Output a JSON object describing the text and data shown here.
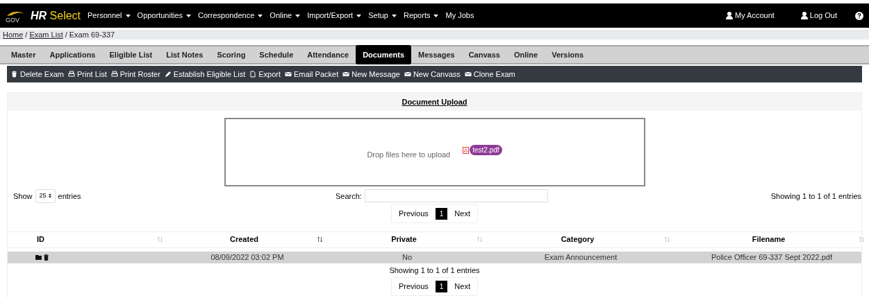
{
  "brand": {
    "logo_text": "GOV",
    "name_bold": "HR",
    "name_rest": "Select"
  },
  "menu": [
    {
      "label": "Personnel",
      "dropdown": true
    },
    {
      "label": "Opportunities",
      "dropdown": true
    },
    {
      "label": "Correspondence",
      "dropdown": true
    },
    {
      "label": "Online",
      "dropdown": true
    },
    {
      "label": "Import/Export",
      "dropdown": true
    },
    {
      "label": "Setup",
      "dropdown": true
    },
    {
      "label": "Reports",
      "dropdown": true
    },
    {
      "label": "My Jobs",
      "dropdown": false
    }
  ],
  "user_links": [
    "My Account",
    "Log Out"
  ],
  "breadcrumb_separator": "/",
  "breadcrumb": [
    {
      "label": "Home",
      "link": true
    },
    {
      "label": "Exam List",
      "link": true
    },
    {
      "label": "Exam 69-337",
      "link": false
    }
  ],
  "tabs": [
    {
      "label": "Master",
      "selected": false
    },
    {
      "label": "Applications",
      "selected": false
    },
    {
      "label": "Eligible List",
      "selected": false
    },
    {
      "label": "List Notes",
      "selected": false
    },
    {
      "label": "Scoring",
      "selected": false
    },
    {
      "label": "Schedule",
      "selected": false
    },
    {
      "label": "Attendance",
      "selected": false
    },
    {
      "label": "Documents",
      "selected": true
    },
    {
      "label": "Messages",
      "selected": false
    },
    {
      "label": "Canvass",
      "selected": false
    },
    {
      "label": "Online",
      "selected": false
    },
    {
      "label": "Versions",
      "selected": false
    }
  ],
  "toolbar": [
    {
      "label": "Delete Exam",
      "kind": "trash"
    },
    {
      "label": "Print List",
      "kind": "print"
    },
    {
      "label": "Print Roster",
      "kind": "print"
    },
    {
      "label": "Establish Eligible List",
      "kind": "pencil"
    },
    {
      "label": "Export",
      "kind": "file"
    },
    {
      "label": "Email Packet",
      "kind": "mail"
    },
    {
      "label": "New Message",
      "kind": "mail"
    },
    {
      "label": "New Canvass",
      "kind": "mail"
    },
    {
      "label": "Clone Exam",
      "kind": "mail"
    }
  ],
  "panel": {
    "title": "Document Upload",
    "dropzone": {
      "message": "Drop files here to upload",
      "file": "test2.pdf"
    }
  },
  "table_controls": {
    "show_label": "Show",
    "page_size": "25",
    "entries_label": "entries",
    "search_label": "Search:",
    "info": "Showing 1 to 1 of 1 entries"
  },
  "pagination_top": {
    "previous": "Previous",
    "pages": [
      {
        "label": "1",
        "selected": true
      }
    ],
    "next": "Next"
  },
  "table": {
    "columns": [
      {
        "label": "ID",
        "sorted": false
      },
      {
        "label": "Created",
        "sorted": true
      },
      {
        "label": "Private",
        "sorted": false
      },
      {
        "label": "Category",
        "sorted": false
      },
      {
        "label": "Filename",
        "sorted": false
      }
    ],
    "rows": [
      {
        "created": "08/09/2022 03:02 PM",
        "private": "No",
        "category": "Exam Announcement",
        "filename": "Police Officer 69-337 Sept 2022.pdf"
      }
    ]
  },
  "footer_info": "Showing 1 to 1 of 1 entries",
  "pagination_bottom": {
    "previous": "Previous",
    "pages": [
      {
        "label": "1",
        "selected": true
      }
    ],
    "next": "Next"
  }
}
